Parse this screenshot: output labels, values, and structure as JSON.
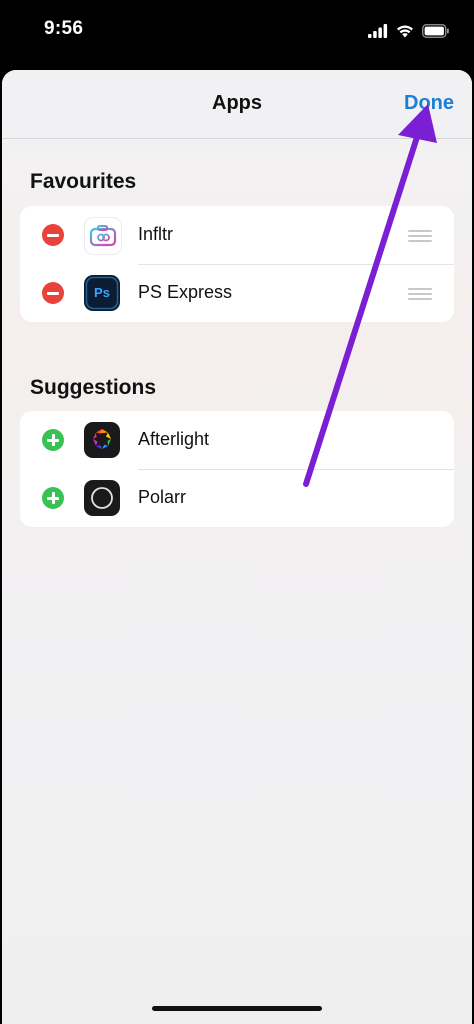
{
  "status_bar": {
    "time": "9:56"
  },
  "sheet": {
    "title": "Apps",
    "done_label": "Done"
  },
  "favourites": {
    "title": "Favourites",
    "items": [
      {
        "label": "Infltr",
        "icon": "infltr-camera-icon"
      },
      {
        "label": "PS Express",
        "icon": "ps-express-icon",
        "icon_text": "Ps"
      }
    ]
  },
  "suggestions": {
    "title": "Suggestions",
    "items": [
      {
        "label": "Afterlight",
        "icon": "afterlight-icon"
      },
      {
        "label": "Polarr",
        "icon": "polarr-icon"
      }
    ]
  },
  "colors": {
    "accent": "#1a7fd6",
    "remove": "#e8423a",
    "add": "#3ac154",
    "annotation_arrow": "#7a1fd4"
  }
}
